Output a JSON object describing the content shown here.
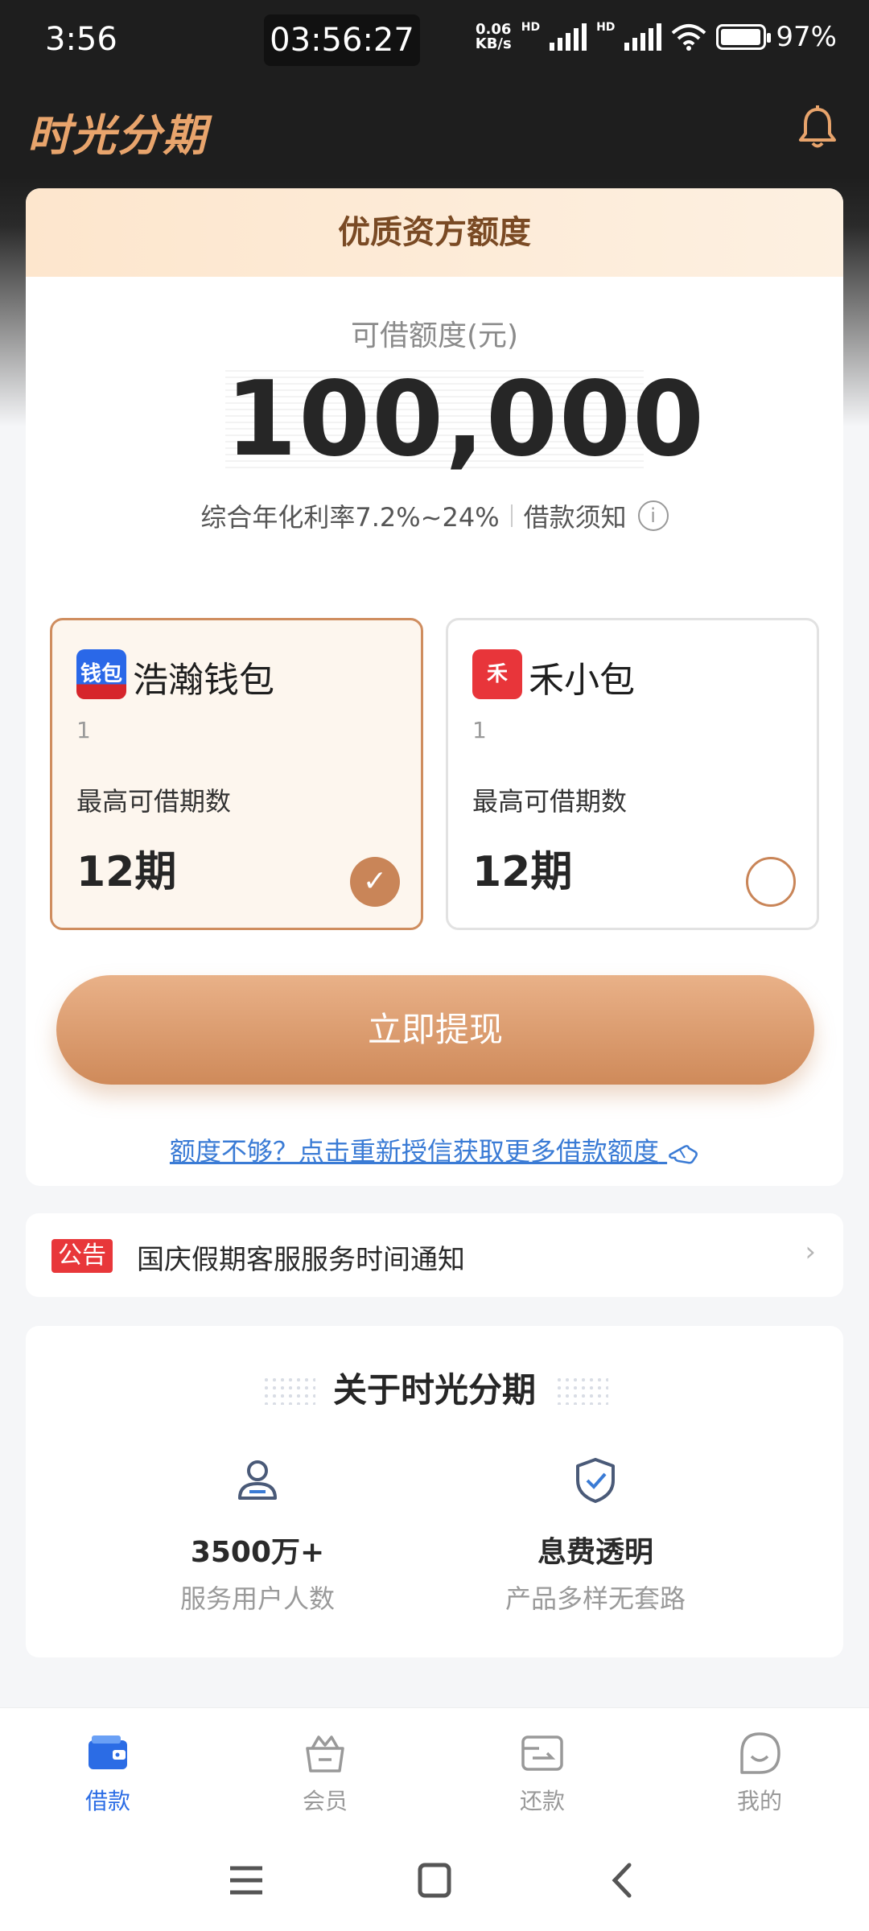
{
  "status": {
    "time": "3:56",
    "clock": "03:56:27",
    "net_speed_top": "0.06",
    "net_speed_bottom": "KB/s",
    "hd1": "HD",
    "hd2": "HD",
    "battery": "97%"
  },
  "app": {
    "title": "时光分期"
  },
  "card": {
    "header": "优质资方额度",
    "quota_label": "可借额度(元)",
    "amount": "100,000",
    "rate": "综合年化利率7.2%~24%",
    "notice_link": "借款须知",
    "info_symbol": "i"
  },
  "options": [
    {
      "logo": "钱包",
      "name": "浩瀚钱包",
      "sub": "1",
      "label": "最高可借期数",
      "value": "12期",
      "selected": true
    },
    {
      "logo": "禾",
      "name": "禾小包",
      "sub": "1",
      "label": "最高可借期数",
      "value": "12期",
      "selected": false
    }
  ],
  "cta": {
    "label": "立即提现"
  },
  "more_link": "额度不够？点击重新授信获取更多借款额度",
  "notice": {
    "badge": "公告",
    "text": "国庆假期客服服务时间通知",
    "arrow": "›"
  },
  "about": {
    "title": "关于时光分期",
    "stats": [
      {
        "icon": "user-icon",
        "value": "3500万+",
        "label": "服务用户人数"
      },
      {
        "icon": "shield-check-icon",
        "value": "息费透明",
        "label": "产品多样无套路"
      }
    ]
  },
  "nav": {
    "items": [
      {
        "icon": "wallet-icon",
        "label": "借款",
        "active": true
      },
      {
        "icon": "crown-basket-icon",
        "label": "会员",
        "active": false
      },
      {
        "icon": "card-icon",
        "label": "还款",
        "active": false
      },
      {
        "icon": "smile-icon",
        "label": "我的",
        "active": false
      }
    ]
  },
  "colors": {
    "accent": "#cf8a5a",
    "link": "#3a7bd5",
    "nav_active": "#2b6ce5",
    "badge": "#e8373a"
  }
}
